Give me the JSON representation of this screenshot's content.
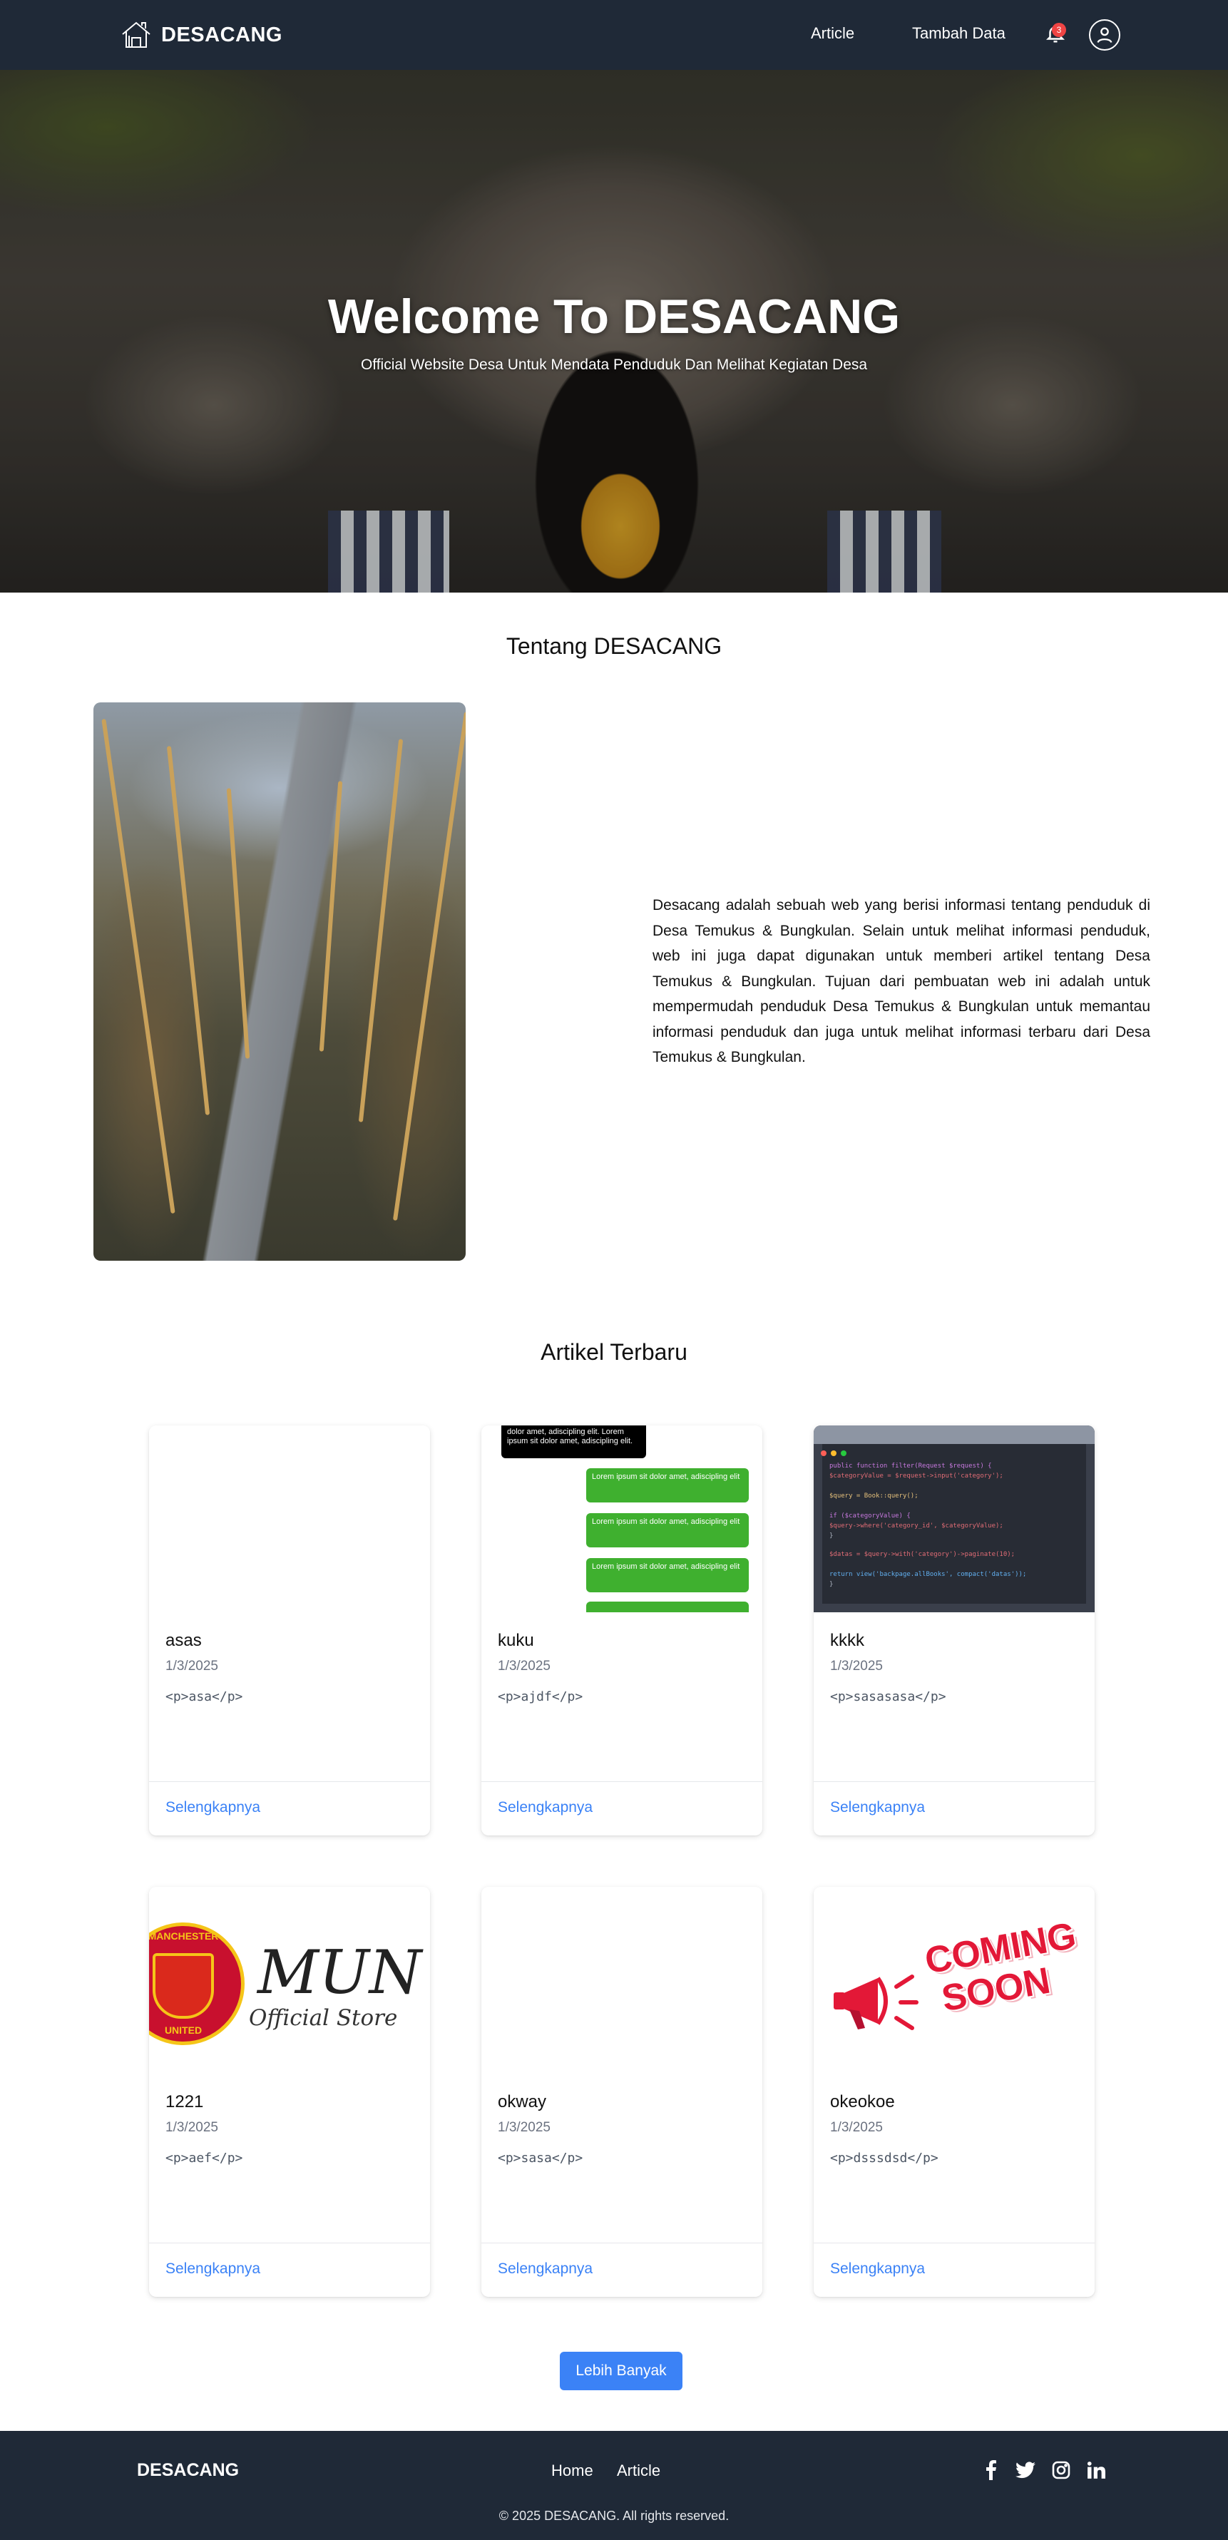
{
  "nav": {
    "brand": "DESACANG",
    "links": [
      "Article",
      "Tambah Data"
    ],
    "notification_count": "3"
  },
  "hero": {
    "title": "Welcome To DESACANG",
    "subtitle": "Official Website Desa Untuk Mendata Penduduk Dan Melihat Kegiatan Desa"
  },
  "about": {
    "title": "Tentang DESACANG",
    "text": "Desacang adalah sebuah web yang berisi informasi tentang penduduk di Desa Temukus & Bungkulan. Selain untuk melihat informasi penduduk, web ini juga dapat digunakan untuk memberi artikel tentang Desa Temukus & Bungkulan. Tujuan dari pembuatan web ini adalah untuk mempermudah penduduk Desa Temukus & Bungkulan untuk memantau informasi penduduk dan juga untuk melihat informasi terbaru dari Desa Temukus & Bungkulan."
  },
  "articles": {
    "title": "Artikel Terbaru",
    "read_more": "Selengkapnya",
    "items": [
      {
        "title": "asas",
        "date": "1/3/2025",
        "excerpt": "<p>asa</p>",
        "thumb": "blank"
      },
      {
        "title": "kuku",
        "date": "1/3/2025",
        "excerpt": "<p>ajdf</p>",
        "thumb": "chat"
      },
      {
        "title": "kkkk",
        "date": "1/3/2025",
        "excerpt": "<p>sasasasa</p>",
        "thumb": "code"
      },
      {
        "title": "1221",
        "date": "1/3/2025",
        "excerpt": "<p>aef</p>",
        "thumb": "mun"
      },
      {
        "title": "okway",
        "date": "1/3/2025",
        "excerpt": "<p>sasa</p>",
        "thumb": "blank"
      },
      {
        "title": "okeokoe",
        "date": "1/3/2025",
        "excerpt": "<p>dsssdsd</p>",
        "thumb": "coming-soon"
      }
    ],
    "more_button": "Lebih Banyak"
  },
  "thumb_text": {
    "chat_header": "dolor amet, adiscipling elit. Lorem ipsum sit dolor amet, adiscipling elit.",
    "chat_bubble": "Lorem ipsum sit dolor amet, adiscipling elit",
    "mun_line1": "MUN",
    "mun_line2": "Official Store",
    "crest_top": "MANCHESTER",
    "crest_bottom": "UNITED",
    "coming": "COMING",
    "soon": "SOON",
    "code_lines": [
      "public function filter(Request $request) {",
      "    $categoryValue = $request->input('category');",
      "    $query = Book::query();",
      "    if ($categoryValue) {",
      "        $query->where('category_id', $categoryValue);",
      "    }",
      "    $datas = $query->with('category')->paginate(10);",
      "    return view('backpage.allBooks', compact('datas'));",
      "}"
    ]
  },
  "footer": {
    "brand": "DESACANG",
    "links": [
      "Home",
      "Article"
    ],
    "social": [
      "facebook-icon",
      "twitter-icon",
      "instagram-icon",
      "linkedin-icon"
    ],
    "copyright": "© 2025 DESACANG. All rights reserved."
  },
  "colors": {
    "nav_bg": "#1f2937",
    "accent": "#3b82f6",
    "badge": "#ef4444"
  }
}
